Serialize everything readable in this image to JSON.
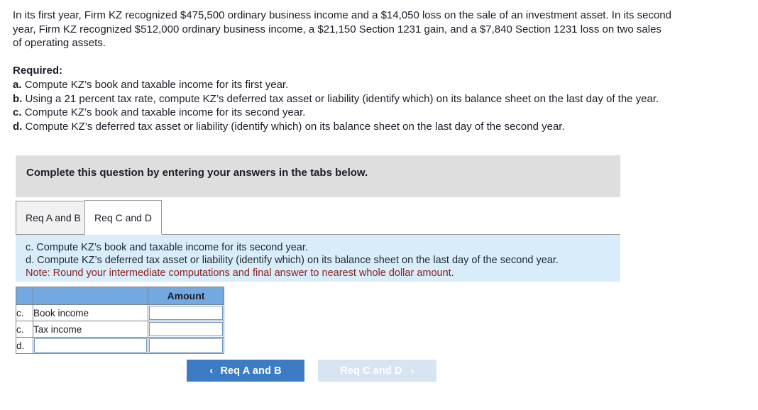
{
  "problem": {
    "text": "In its first year, Firm KZ recognized $475,500 ordinary business income and a $14,050 loss on the sale of an investment asset. In its second year, Firm KZ recognized $512,000 ordinary business income, a $21,150 Section 1231 gain, and a $7,840 Section 1231 loss on two sales of operating assets."
  },
  "required": {
    "title": "Required:",
    "items": [
      {
        "label": "a.",
        "text": "Compute KZ’s book and taxable income for its first year."
      },
      {
        "label": "b.",
        "text": "Using a 21 percent tax rate, compute KZ’s deferred tax asset or liability (identify which) on its balance sheet on the last day of the year."
      },
      {
        "label": "c.",
        "text": "Compute KZ’s book and taxable income for its second year."
      },
      {
        "label": "d.",
        "text": "Compute KZ’s deferred tax asset or liability (identify which) on its balance sheet on the last day of the second year."
      }
    ]
  },
  "banner": {
    "text": "Complete this question by entering your answers in the tabs below."
  },
  "tabs": [
    {
      "label": "Req A and B",
      "active": false
    },
    {
      "label": "Req C and D",
      "active": true
    }
  ],
  "info_panel": {
    "line1": "c. Compute KZ’s book and taxable income for its second year.",
    "line2": "d. Compute KZ’s deferred tax asset or liability (identify which) on its balance sheet on the last day of the second year.",
    "note": "Note: Round your intermediate computations and final answer to nearest whole dollar amount.",
    "note_color": "#8b2020",
    "background": "#d9ecf9"
  },
  "answer_table": {
    "header": {
      "blank1": "",
      "blank2": "",
      "amount": "Amount"
    },
    "header_color": "#73a9e0",
    "rows": [
      {
        "label": "c.",
        "description": "Book income",
        "description_editable": false,
        "amount": "",
        "amount_editable": true
      },
      {
        "label": "c.",
        "description": "Tax income",
        "description_editable": false,
        "amount": "",
        "amount_editable": true
      },
      {
        "label": "d.",
        "description": "",
        "description_editable": true,
        "amount": "",
        "amount_editable": true
      }
    ]
  },
  "buttons": {
    "prev": {
      "label": "Req A and B",
      "chevron": "‹",
      "enabled": true,
      "color": "#3b7cc4"
    },
    "next": {
      "label": "Req C and D",
      "chevron": "›",
      "enabled": false,
      "color": "#d7e4f2"
    }
  }
}
